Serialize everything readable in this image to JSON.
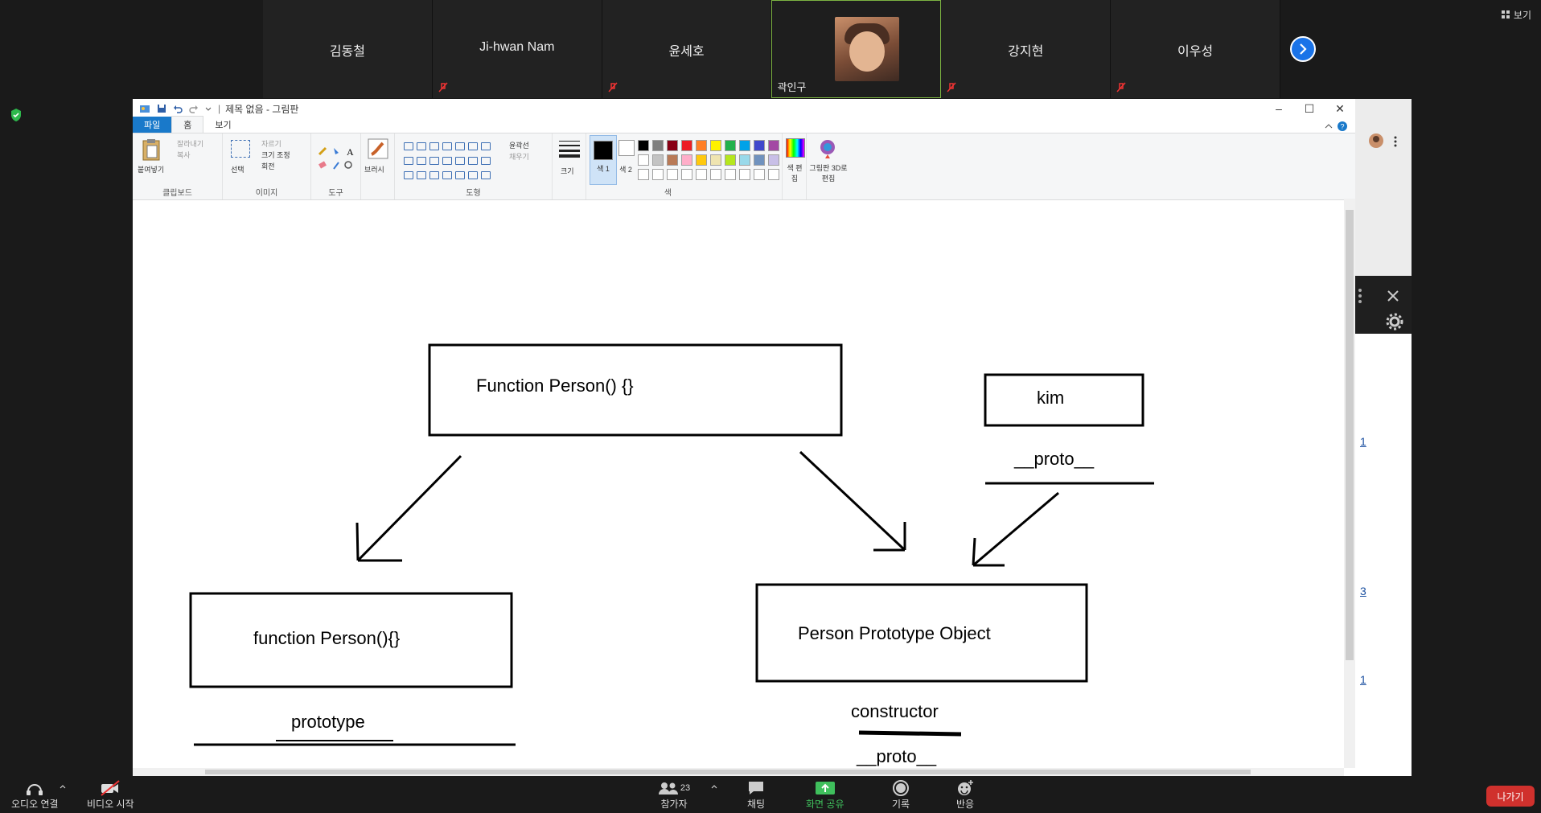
{
  "participants": [
    {
      "name": "김동철",
      "muted": false
    },
    {
      "name": "Ji-hwan Nam",
      "muted": true
    },
    {
      "name": "윤세호",
      "muted": true
    },
    {
      "name": "곽인구",
      "muted": false,
      "video": true
    },
    {
      "name": "강지현",
      "muted": true
    },
    {
      "name": "이우성",
      "muted": true
    }
  ],
  "top_right_view_label": "보기",
  "paint": {
    "title": "제목 없음 - 그림판",
    "tabs": [
      "파일",
      "홈",
      "보기"
    ],
    "groups": {
      "clipboard": {
        "label": "클립보드",
        "paste": "붙여넣기",
        "cut": "잘라내기",
        "copy": "복사"
      },
      "image": {
        "label": "이미지",
        "select": "선택",
        "crop": "자르기",
        "resize": "크기 조정",
        "rotate": "회전"
      },
      "tools": {
        "label": "도구",
        "brushes": "브러시"
      },
      "shapes": {
        "label": "도형",
        "outline": "윤곽선",
        "fill": "채우기"
      },
      "size": {
        "label": "크기"
      },
      "colors": {
        "label": "색",
        "color1": "색 1",
        "color2": "색 2",
        "edit": "색 편집",
        "paint3d": "그림판 3D로 편집"
      }
    },
    "palette": [
      "#000000",
      "#7f7f7f",
      "#880015",
      "#ed1c24",
      "#ff7f27",
      "#fff200",
      "#22b14c",
      "#00a2e8",
      "#3f48cc",
      "#a349a4",
      "#ffffff",
      "#c3c3c3",
      "#b97a57",
      "#ffaec9",
      "#ffc90e",
      "#efe4b0",
      "#b5e61d",
      "#99d9ea",
      "#7092be",
      "#c8bfe7",
      "#ffffff",
      "#ffffff",
      "#ffffff",
      "#ffffff",
      "#ffffff",
      "#ffffff",
      "#ffffff",
      "#ffffff",
      "#ffffff",
      "#ffffff"
    ],
    "diagram": {
      "function_person_top": "Function Person() {}",
      "kim": "kim",
      "kim_proto": "__proto__",
      "function_person_left": "function Person(){}",
      "prototype": "prototype",
      "person_prototype_object": "Person Prototype Object",
      "constructor": "constructor",
      "proto_bottom": "__proto__"
    }
  },
  "right_panel_links": [
    "1",
    "3",
    "1"
  ],
  "toolbar": {
    "audio": "오디오 연결",
    "video": "비디오 시작",
    "participants": "참가자",
    "participants_count": "23",
    "chat": "채팅",
    "share": "화면 공유",
    "record": "기록",
    "reactions": "반응",
    "leave": "나가기"
  }
}
